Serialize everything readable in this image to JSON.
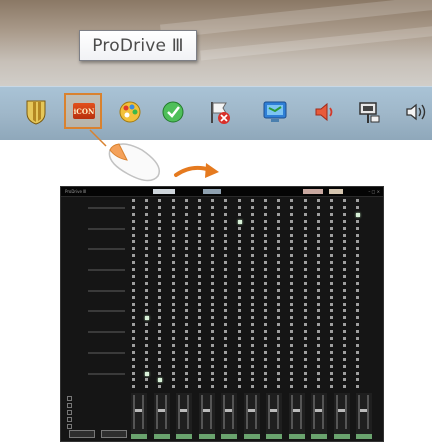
{
  "tooltip": {
    "text": "ProDrive Ⅲ"
  },
  "tray": {
    "icons": [
      "shield-icon",
      "icon-app-icon",
      "palette-icon",
      "check-icon",
      "flag-error-icon",
      "monitor-icon",
      "volume-icon",
      "network-icon",
      "sound-icon"
    ],
    "app_logo_text": "iCON"
  },
  "colors": {
    "taskbar": "#9fb7c9",
    "highlight": "#d9822f",
    "mixer_bg": "#151515",
    "matrix_cell": "#9f9f9f",
    "matrix_cell_on": "#d8f0d8",
    "strip_label": "#6aa36e"
  },
  "mixer": {
    "title": "ProDrive Ⅲ",
    "rows": 28,
    "cols": 18,
    "active_cells": [
      [
        3,
        8
      ],
      [
        2,
        17
      ],
      [
        3,
        18
      ],
      [
        17,
        1
      ],
      [
        25,
        1
      ],
      [
        26,
        2
      ]
    ]
  }
}
